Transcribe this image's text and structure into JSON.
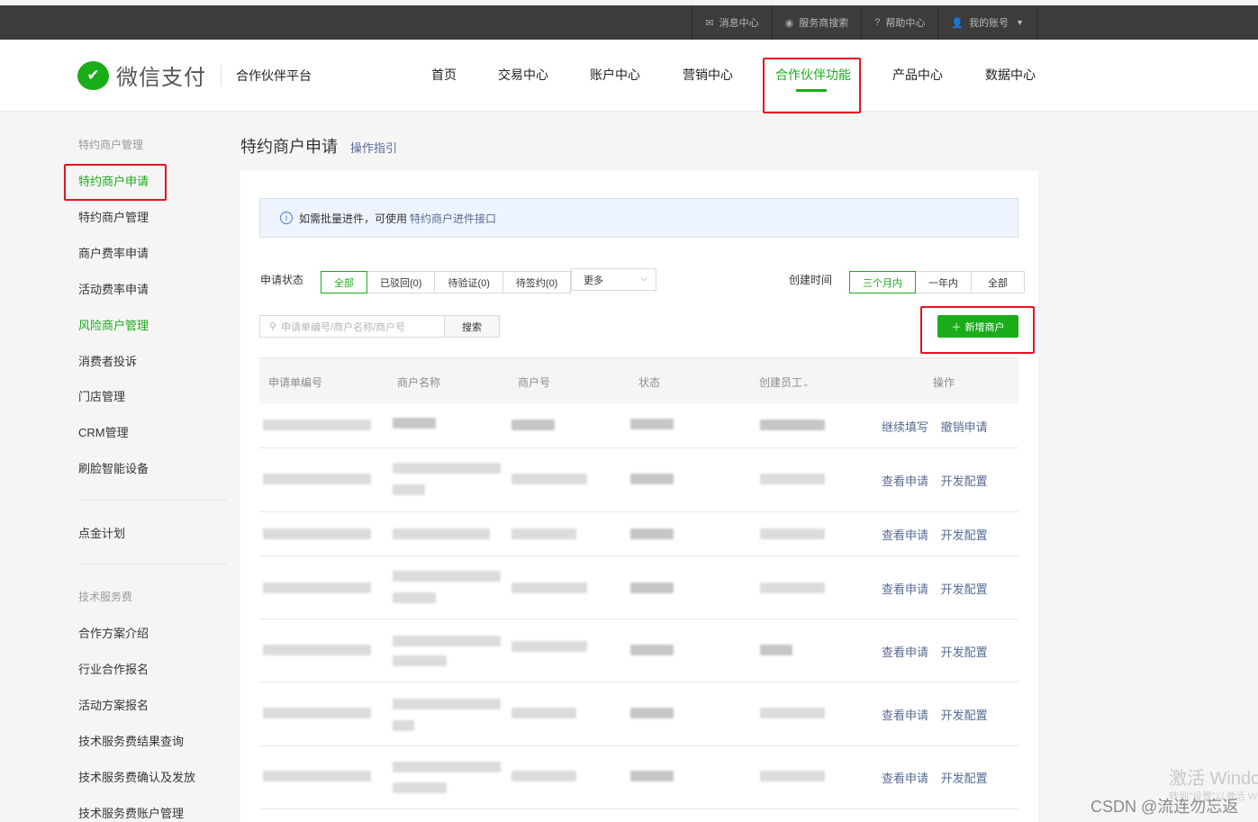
{
  "topbar": {
    "links": [
      {
        "icon": "mail-icon",
        "glyph": "✉",
        "label": "消息中心"
      },
      {
        "icon": "search-icon",
        "glyph": "◉",
        "label": "服务商搜索"
      },
      {
        "icon": "help-icon",
        "glyph": "?",
        "label": "帮助中心"
      },
      {
        "icon": "user-icon",
        "glyph": "👤",
        "label": "我的账号"
      }
    ]
  },
  "header": {
    "brand": "微信支付",
    "platform": "合作伙伴平台",
    "nav": [
      "首页",
      "交易中心",
      "账户中心",
      "营销中心",
      "合作伙伴功能",
      "产品中心",
      "数据中心"
    ],
    "active_nav": "合作伙伴功能"
  },
  "sidebar": {
    "group1": "特约商户管理",
    "items1": [
      "特约商户申请",
      "特约商户管理",
      "商户费率申请",
      "活动费率申请",
      "风险商户管理",
      "消费者投诉",
      "门店管理",
      "CRM管理",
      "刷脸智能设备"
    ],
    "items2": [
      "点金计划"
    ],
    "group3": "技术服务费",
    "items3": [
      "合作方案介绍",
      "行业合作报名",
      "活动方案报名",
      "技术服务费结果查询",
      "技术服务费确认及发放",
      "技术服务费账户管理"
    ]
  },
  "main": {
    "title": "特约商户申请",
    "guide_link": "操作指引",
    "tip_text": "如需批量进件，可使用",
    "tip_link": "特约商户进件接口",
    "status_label": "申请状态",
    "status_options": [
      "全部",
      "已驳回(0)",
      "待验证(0)",
      "待签约(0)"
    ],
    "more_label": "更多",
    "time_label": "创建时间",
    "time_options": [
      "三个月内",
      "一年内",
      "全部"
    ],
    "search_placeholder": "申请单编号/商户名称/商户号",
    "search_button": "搜索",
    "add_button": "新增商户",
    "columns": [
      "申请单编号",
      "商户名称",
      "商户号",
      "状态",
      "创建员工",
      "操作"
    ],
    "rows": [
      {
        "actions": [
          "继续填写",
          "撤销申请"
        ]
      },
      {
        "actions": [
          "查看申请",
          "开发配置"
        ]
      },
      {
        "actions": [
          "查看申请",
          "开发配置"
        ]
      },
      {
        "actions": [
          "查看申请",
          "开发配置"
        ]
      },
      {
        "actions": [
          "查看申请",
          "开发配置"
        ]
      },
      {
        "actions": [
          "查看申请",
          "开发配置"
        ]
      },
      {
        "actions": [
          "查看申请",
          "开发配置"
        ]
      }
    ]
  },
  "watermark": {
    "windows_line1": "激活 Windows",
    "windows_line2": "转到\"设置\"以激活 Windows。",
    "csdn": "CSDN @流连勿忘返"
  },
  "colors": {
    "brand_green": "#1aad19",
    "link_blue": "#576b95",
    "annotation_red": "#e1141e"
  }
}
